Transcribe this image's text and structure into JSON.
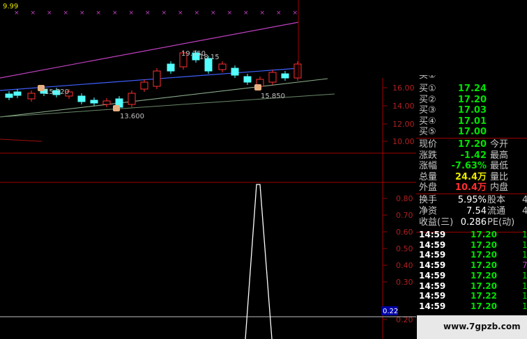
{
  "chart_top": {
    "indicator_label": "9.99",
    "price_scale": [
      "16.00",
      "14.00",
      "12.00",
      "10.00"
    ],
    "annotations": [
      "19.750",
      "18.15",
      "15.720",
      "13.600",
      "15.850"
    ]
  },
  "chart_bottom": {
    "scale": [
      "0.80",
      "0.70",
      "0.60",
      "0.50",
      "0.40",
      "0.30",
      "0.20"
    ],
    "current_value": "0.22"
  },
  "quote": {
    "bids": [
      {
        "label": "买①",
        "value": "17.24"
      },
      {
        "label": "买②",
        "value": "17.20"
      },
      {
        "label": "买③",
        "value": "17.03"
      },
      {
        "label": "买④",
        "value": "17.01"
      },
      {
        "label": "买⑤",
        "value": "17.00"
      }
    ],
    "stats": [
      {
        "label": "现价",
        "value": "17.20",
        "label2": "今开",
        "color": "#00e000"
      },
      {
        "label": "涨跌",
        "value": "-1.42",
        "label2": "最高",
        "color": "#00e000"
      },
      {
        "label": "涨幅",
        "value": "-7.63%",
        "label2": "最低",
        "color": "#00e000"
      },
      {
        "label": "总量",
        "value": "24.4万",
        "label2": "量比",
        "color": "#e8e800"
      },
      {
        "label": "外盘",
        "value": "10.4万",
        "label2": "内盘",
        "color": "#ff3030"
      }
    ],
    "info": [
      {
        "label": "换手",
        "value": "5.95%",
        "label2": "股本",
        "tail": "4"
      },
      {
        "label": "净资",
        "value": "7.54",
        "label2": "流通",
        "tail": "4"
      },
      {
        "label": "收益(三)",
        "value": "0.286",
        "label2": "PE(动)",
        "tail": ""
      }
    ],
    "ticks": [
      {
        "time": "14:59",
        "price": "17.20",
        "tail": "1"
      },
      {
        "time": "14:59",
        "price": "17.20",
        "tail": "1"
      },
      {
        "time": "14:59",
        "price": "17.20",
        "tail": "1"
      },
      {
        "time": "14:59",
        "price": "17.20",
        "tail": "7"
      },
      {
        "time": "14:59",
        "price": "17.20",
        "tail": "1"
      },
      {
        "time": "14:59",
        "price": "17.20",
        "tail": "1"
      },
      {
        "time": "14:59",
        "price": "17.22",
        "tail": "1"
      },
      {
        "time": "14:59",
        "price": "17.20",
        "tail": "1"
      }
    ]
  },
  "watermark": "www.7gpzb.com",
  "colors": {
    "up": "#ff3030",
    "down": "#54ffff",
    "ma_magenta": "#c040c0",
    "ma_blue": "#4060ff",
    "ma_green": "#90b090",
    "grid": "#a00000"
  }
}
